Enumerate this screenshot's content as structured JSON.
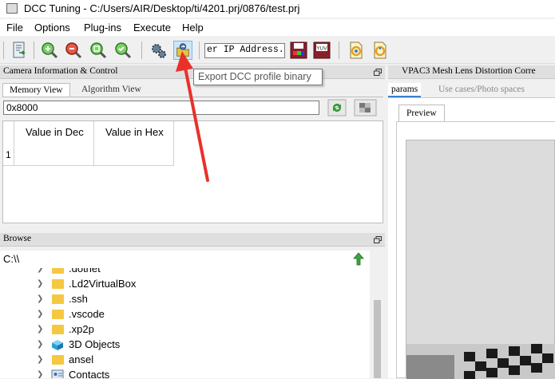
{
  "window": {
    "title": "DCC Tuning - C:/Users/AIR/Desktop/ti/4201.prj/0876/test.prj"
  },
  "menu": [
    {
      "label": "File",
      "mnemonic": "F"
    },
    {
      "label": "Options",
      "mnemonic": "O"
    },
    {
      "label": "Plug-ins",
      "mnemonic": "P"
    },
    {
      "label": "Execute",
      "mnemonic": "E"
    },
    {
      "label": "Help",
      "mnemonic": "H"
    }
  ],
  "toolbar": {
    "ip_value": "er IP Address...",
    "tooltip": "Export DCC profile binary",
    "icons": [
      "export-file-icon",
      "zoom-in-icon",
      "zoom-out-icon",
      "zoom-fit-icon",
      "zoom-check-icon",
      "settings-gears-icon",
      "export-dcc-binary-icon",
      "save-floppy-icon",
      "yuv-save-icon",
      "page-refresh-icon-1",
      "page-refresh-icon-2"
    ]
  },
  "camera_panel": {
    "title": "Camera Information & Control",
    "tabs": [
      "Memory View",
      "Algorithm View"
    ],
    "address": "0x8000",
    "table": {
      "columns": [
        "Value in Dec",
        "Value in Hex"
      ],
      "rows": [
        {
          "index": "1"
        }
      ]
    }
  },
  "browse_panel": {
    "title": "Browse",
    "path": "C:\\\\",
    "items": [
      {
        "label": ".dotnet",
        "type": "folder"
      },
      {
        "label": ".Ld2VirtualBox",
        "type": "folder"
      },
      {
        "label": ".ssh",
        "type": "folder"
      },
      {
        "label": ".vscode",
        "type": "folder"
      },
      {
        "label": ".xp2p",
        "type": "folder"
      },
      {
        "label": "3D Objects",
        "type": "3d"
      },
      {
        "label": "ansel",
        "type": "folder"
      },
      {
        "label": "Contacts",
        "type": "contacts"
      }
    ]
  },
  "right_panel": {
    "title": "VPAC3 Mesh Lens Distortion Corre",
    "tabs": [
      "params",
      "Use cases/Photo spaces"
    ],
    "subtab": "Preview"
  },
  "colors": {
    "accent_red": "#e8312a",
    "folder": "#f5c842",
    "up_arrow": "#3aa83a"
  }
}
